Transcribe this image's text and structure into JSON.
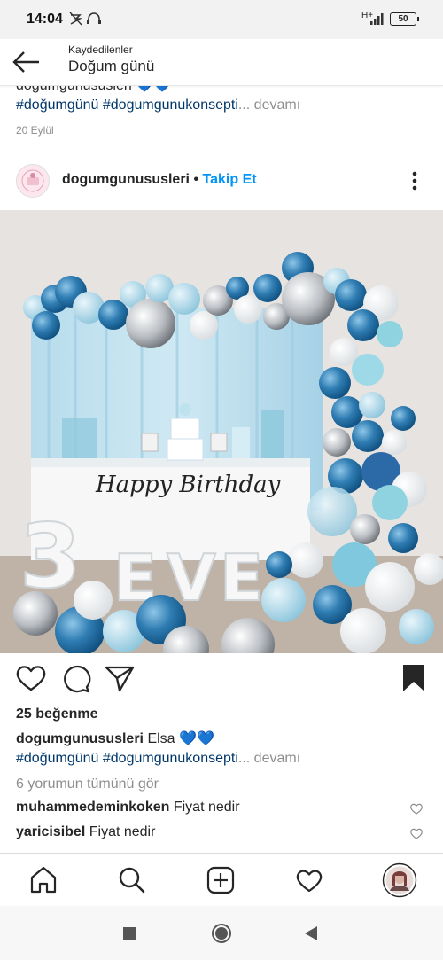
{
  "status_bar": {
    "time": "14:04",
    "network": "H+",
    "battery": "50"
  },
  "header": {
    "section": "Kaydedilenler",
    "title": "Doğum günü"
  },
  "previous_post": {
    "caption_cut": "dogumgunususleri 💙💙",
    "tag1": "#doğumgünü",
    "tag2": "#dogumgunukonsepti",
    "more": "... devamı",
    "date": "20 Eylül"
  },
  "post": {
    "username": "dogumgunususleri",
    "separator": "•",
    "follow": "Takip Et",
    "photo": {
      "banner": "Happy Birthday",
      "letters": [
        "3",
        "E",
        "V",
        "E"
      ]
    },
    "likes": "25 beğenme",
    "caption_user": "dogumgunususleri",
    "caption_text": "Elsa",
    "caption_hearts": "💙💙",
    "tag1": "#doğumgünü",
    "tag2": "#dogumgunukonsepti",
    "more": "... devamı",
    "view_all": "6 yorumun tümünü gör",
    "comments": [
      {
        "user": "muhammedeminkoken",
        "text": "Fiyat nedir"
      },
      {
        "user": "yaricisibel",
        "text": "Fiyat nedir"
      }
    ]
  },
  "icons": {
    "back": "arrow-left",
    "menu": "three-dots-vertical",
    "like": "heart-outline",
    "comment": "speech-bubble",
    "share": "paper-plane",
    "save": "bookmark-filled"
  },
  "colors": {
    "link": "#00376b",
    "follow": "#0095f6",
    "muted": "#8e8e8e"
  }
}
